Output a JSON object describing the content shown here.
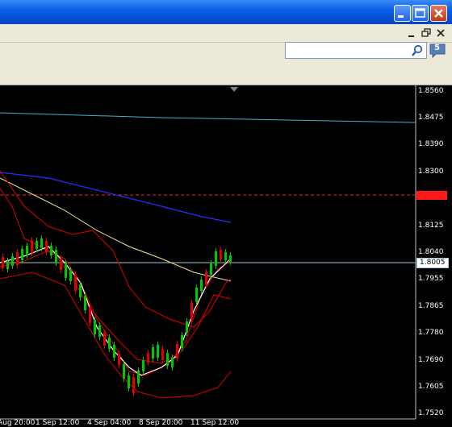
{
  "window": {
    "controls": [
      "minimize",
      "maximize",
      "close"
    ],
    "colors": {
      "titlebar": "#0a5fe3",
      "close_button": "#c4381b"
    }
  },
  "mdi_controls": [
    "minimize",
    "restore",
    "close"
  ],
  "toolbar": {
    "search": {
      "value": "",
      "placeholder": ""
    },
    "search_icon": "magnifier-icon",
    "messages_badge": "5"
  },
  "chart": {
    "colors": {
      "background": "#000000",
      "candles_up": "#00c800",
      "band": "#e00000",
      "ma_slow": "#2c2cff",
      "ma_mid": "#f0e68c",
      "ma_fast": "#ffffff",
      "ma_long": "#48b0c8",
      "level_line": "#ff2020",
      "bid_line": "#9ec8e0"
    },
    "y_ticks": [
      "1.8560",
      "1.8475",
      "1.8390",
      "1.8300",
      "1.8125",
      "1.8040",
      "1.7955",
      "1.7865",
      "1.7780",
      "1.7690",
      "1.7605",
      "1.7520"
    ],
    "x_ticks": [
      "Aug 20:00",
      "1 Sep 12:00",
      "4 Sep 04:00",
      "8 Sep 20:00",
      "11 Sep 12:00"
    ],
    "level_tag": "1.8227",
    "bid_tag": "1.8005"
  }
}
